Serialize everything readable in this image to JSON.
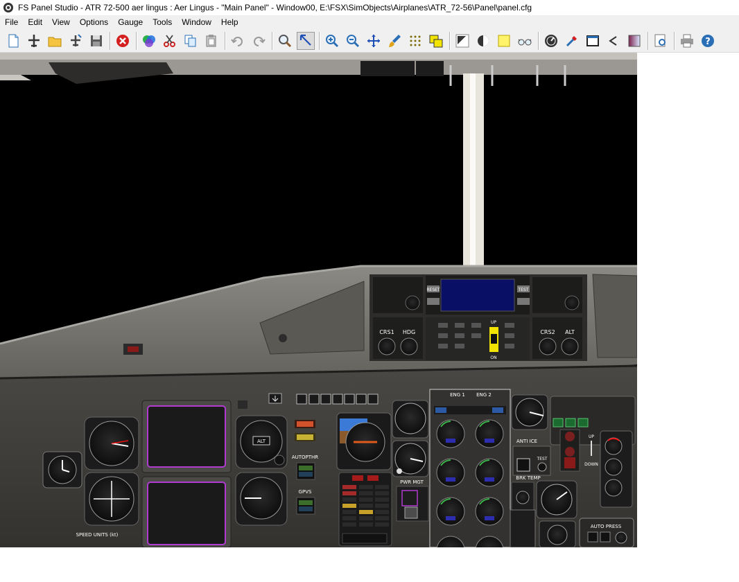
{
  "window": {
    "title": "FS Panel Studio - ATR 72-500 aer lingus : Aer Lingus - \"Main Panel\" - Window00, E:\\FSX\\SimObjects\\Airplanes\\ATR_72-56\\Panel\\panel.cfg",
    "app_icon": "fs-panel-studio-icon"
  },
  "menu": {
    "items": [
      {
        "label": "File"
      },
      {
        "label": "Edit"
      },
      {
        "label": "View"
      },
      {
        "label": "Options"
      },
      {
        "label": "Gauge"
      },
      {
        "label": "Tools"
      },
      {
        "label": "Window"
      },
      {
        "label": "Help"
      }
    ]
  },
  "toolbar": {
    "buttons": [
      "new-file-icon",
      "new-aircraft-icon",
      "open-folder-icon",
      "open-aircraft-icon",
      "save-icon",
      "close-red-icon",
      "colors-icon",
      "cut-icon",
      "copy-icon",
      "paste-icon",
      "undo-icon",
      "redo-icon",
      "find-icon",
      "select-arrow-icon",
      "zoom-in-icon",
      "zoom-out-icon",
      "move-icon",
      "brush-icon",
      "grid-icon",
      "layers-icon",
      "dark-panel-icon",
      "night-icon",
      "yellow-frame-icon",
      "glasses-icon",
      "gauge-icon",
      "tools-icon",
      "window-icon",
      "back-icon",
      "gradient-icon",
      "preview-icon",
      "print-icon",
      "help-icon"
    ]
  },
  "panel": {
    "instrument_labels": {
      "crs1": "CRS1",
      "hdg": "HDG",
      "crs2": "CRS2",
      "alt": "ALT",
      "up": "UP",
      "on": "ON",
      "autopthr": "AUTOPTHR",
      "gpvs": "GPVS",
      "pwr_mgt": "PWR MGT",
      "eng1": "ENG 1",
      "eng2": "ENG 2",
      "anti_ice": "ANTI ICE",
      "brk_temp": "BRK TEMP",
      "auto_press": "AUTO PRESS",
      "speed_units": "SPEED UNITS (kt)",
      "reset": "RESET",
      "test": "TEST",
      "down": "DOWN"
    },
    "colors": {
      "panel_gray": "#3c3b39",
      "glareshield": "#6f6e69",
      "mfd_frame": "#b13bd1",
      "fmc_screen": "#0a0f66",
      "annunciator_yellow": "#f2e400"
    }
  }
}
